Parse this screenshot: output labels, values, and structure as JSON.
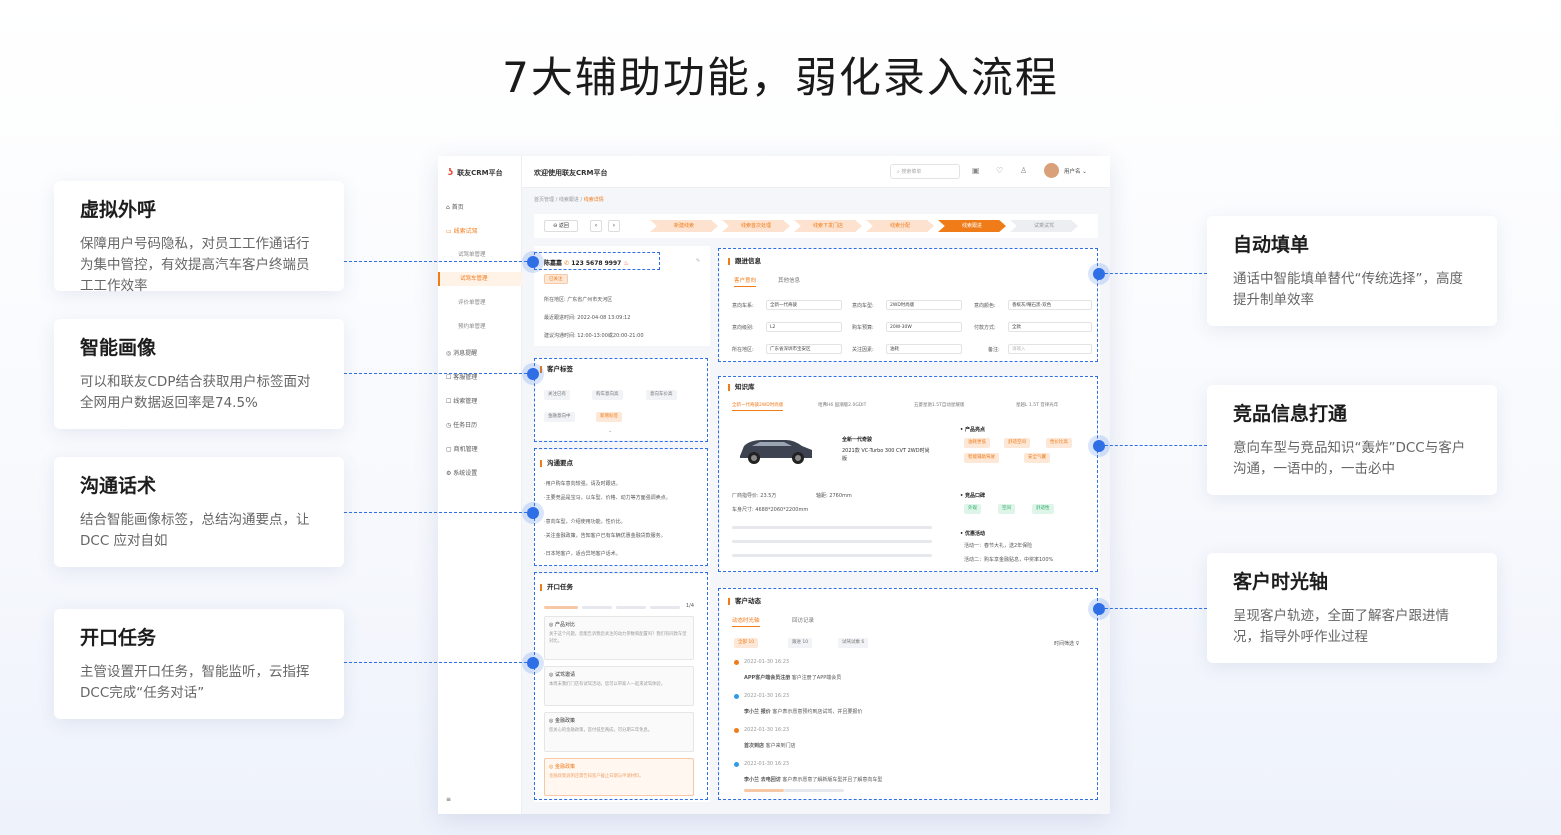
{
  "headline": "7大辅助功能，弱化录入流程",
  "features_left": [
    {
      "title": "虚拟外呼",
      "desc": "保障用户号码隐私，对员工工作通话行为集中管控，有效提高汽车客户终端员工工作效率"
    },
    {
      "title": "智能画像",
      "desc": "可以和联友CDP结合获取用户标签面对全网用户数据返回率是74.5%"
    },
    {
      "title": "沟通话术",
      "desc": "结合智能画像标签，总结沟通要点，让DCC 应对自如"
    },
    {
      "title": "开口任务",
      "desc": "主管设置开口任务，智能监听，云指挥DCC完成“任务对话”"
    }
  ],
  "features_right": [
    {
      "title": "自动填单",
      "desc": "通话中智能填单替代“传统选择”，高度提升制单效率"
    },
    {
      "title": "竞品信息打通",
      "desc": "意向车型与竞品知识“轰炸”DCC与客户沟通，一语中的，一击必中"
    },
    {
      "title": "客户时光轴",
      "desc": "呈现客户轨迹，全面了解客户跟进情况，指导外呼作业过程"
    }
  ],
  "crm": {
    "logo": "联友CRM平台",
    "welcome": "欢迎使用联友CRM平台",
    "search_placeholder": "搜索菜单",
    "username": "用户名",
    "sidebar": [
      {
        "label": "首页"
      },
      {
        "label": "线索试驾"
      },
      {
        "label": "试驾单管理"
      },
      {
        "label": "试驾车管理"
      },
      {
        "label": "评价单管理"
      },
      {
        "label": "预约单管理"
      },
      {
        "label": "消息提醒"
      },
      {
        "label": "客服管理"
      },
      {
        "label": "线索管理"
      },
      {
        "label": "任务日历"
      },
      {
        "label": "商机管理"
      },
      {
        "label": "系统设置"
      }
    ],
    "breadcrumb": [
      "首页管理",
      "线索跟进",
      "线索详情"
    ],
    "back": "返回",
    "steps": [
      "新建线索",
      "线索首次处理",
      "线索下发门店",
      "线索分配",
      "线索跟进",
      "试乘试驾"
    ],
    "customer": {
      "name": "陈嘉嘉",
      "phone": "123 5678 9997",
      "tag": "已关注",
      "region_label": "所在地区:",
      "region": "广东省广州市天河区",
      "last_label": "最近跟进时间:",
      "last": "2022-04-08 13:09:12",
      "suggest_label": "建议沟通时间:",
      "suggest": "12:00-13:00或20:00-21:00"
    },
    "tags_title": "客户标签",
    "tags": [
      "关注已有",
      "购车意向高",
      "意向车价高",
      "金融意向中",
      "新增标签"
    ],
    "talk_title": "沟通要点",
    "talk_points": [
      "·用户购车意向较强，请及时跟进。",
      "·主要竞品是宝马，以车型、价格、动力等方面强调卖点。",
      "·意向车型，介绍使用功能，性价比。",
      "·关注金融政策，告知客户已有车辆优惠金融贷款服务。",
      "·日本地客户，适合异地客户话术。"
    ],
    "task_title": "开口任务",
    "task_progress": "1/4",
    "tasks": [
      {
        "title": "产品对比",
        "text": "关于这个问题，您能告诉我您关注的动力参数和配置吗？我们有同款车型对比。"
      },
      {
        "title": "试驾邀请",
        "text": "本周末我们门店有试驾活动，您可以带家人一起来试驾体验。"
      },
      {
        "title": "金融政策",
        "text": "您关心的金融政策，首付低至两成，可分期三年免息。"
      },
      {
        "title": "金融政策",
        "text": "金融政策说明还需告知客户截止日期与申请材料。"
      }
    ],
    "follow_title": "跟进信息",
    "follow_tabs": [
      "客户意向",
      "其他信息"
    ],
    "form": [
      {
        "label": "意向车系:",
        "value": "全新一代奇骏"
      },
      {
        "label": "意向车型:",
        "value": "2WD时尚版"
      },
      {
        "label": "意向颜色:",
        "value": "香槟灰/曜石黑-双色"
      },
      {
        "label": "意向级别:",
        "value": "L2"
      },
      {
        "label": "购车预算:",
        "value": "20W-30W"
      },
      {
        "label": "付款方式:",
        "value": "全款"
      },
      {
        "label": "所在地区:",
        "value": "广东省深圳市宝安区"
      },
      {
        "label": "关注因素:",
        "value": "油耗"
      },
      {
        "label": "备注:",
        "value": "请输入"
      }
    ],
    "knowledge_title": "知识库",
    "knowledge_tabs": [
      "全新一代奇骏2WD时尚版",
      "哈弗H6 国潮版2.0GDIT",
      "五菱星驰1.5T自动星耀版",
      "星越L 1.5T 音律光年"
    ],
    "car_name": "全新一代奇骏",
    "car_model": "2021款 VC-Turbo 300 CVT 2WD时尚版",
    "spec_price_label": "厂商指导价:",
    "spec_price": "23.5万",
    "spec_wheelbase_label": "轴距:",
    "spec_wheelbase": "2760mm",
    "spec_size_label": "车身尺寸:",
    "spec_size": "4688*2060*2200mm",
    "highlight_title": "产品亮点",
    "highlights": [
      "油耗更低",
      "舒适空间",
      "性价比高",
      "智能辅助驾驶",
      "安全气囊"
    ],
    "compare_title": "竞品口碑",
    "compares": [
      "外观",
      "空间",
      "舒适性"
    ],
    "promo_title": "优惠活动",
    "promo": [
      "活动一：春节大礼，送2年保险",
      "活动二：购车享金融贴息，中奖率100%"
    ],
    "dynamic_title": "客户动态",
    "dynamic_tabs": [
      "动态时光轴",
      "回访记录"
    ],
    "dynamic_filters": [
      "全部 10",
      "跟进 10",
      "试驾试乘 6"
    ],
    "dynamic_filter_label": "时间筛选",
    "timeline": [
      {
        "time": "2022-01-30 16:23",
        "title": "APP客户端会员注册",
        "text": "客户注册了APP端会员"
      },
      {
        "time": "2022-01-30 16:23",
        "title": "李小兰  报价",
        "text": "客户表示愿意预约到店试驾，并且要报价"
      },
      {
        "time": "2022-01-30 16:23",
        "title": "首次到店",
        "text": "客户来到门店"
      },
      {
        "time": "2022-01-30 16:23",
        "title": "李小兰  去电回访",
        "text": "客户表示愿意了解新版车型并且了解意向车型"
      }
    ]
  }
}
